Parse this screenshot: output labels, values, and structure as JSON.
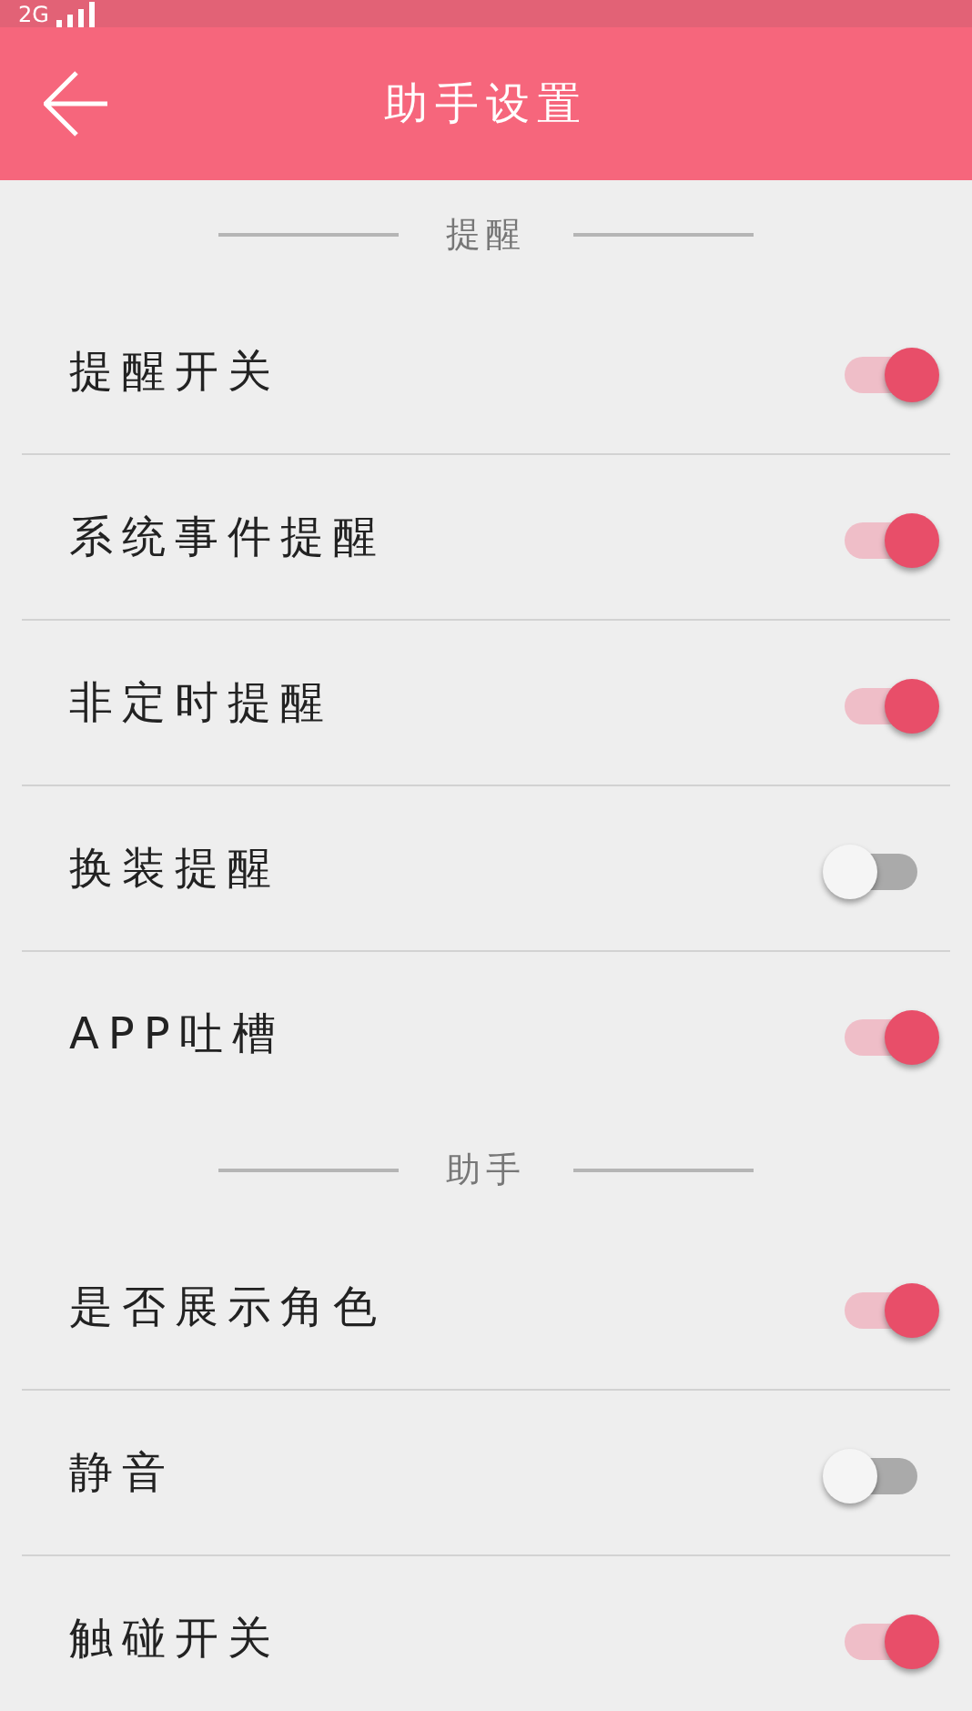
{
  "status_bar": {
    "network": "2G"
  },
  "header": {
    "title": "助手设置"
  },
  "sections": [
    {
      "title": "提醒",
      "items": [
        {
          "label": "提醒开关",
          "on": true
        },
        {
          "label": "系统事件提醒",
          "on": true
        },
        {
          "label": "非定时提醒",
          "on": true
        },
        {
          "label": "换装提醒",
          "on": false
        },
        {
          "label": "APP吐槽",
          "on": true
        }
      ]
    },
    {
      "title": "助手",
      "items": [
        {
          "label": "是否展示角色",
          "on": true
        },
        {
          "label": "静音",
          "on": false
        },
        {
          "label": "触碰开关",
          "on": true
        }
      ]
    }
  ]
}
